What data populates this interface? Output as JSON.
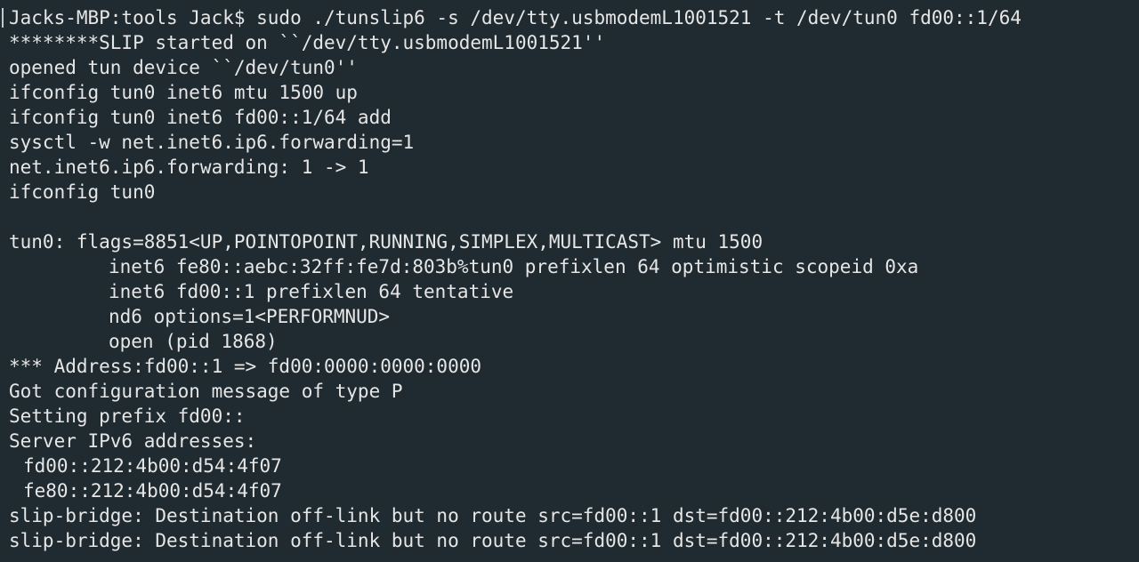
{
  "terminal": {
    "lines": [
      "Jacks-MBP:tools Jack$ sudo ./tunslip6 -s /dev/tty.usbmodemL1001521 -t /dev/tun0 fd00::1/64",
      "********SLIP started on ``/dev/tty.usbmodemL1001521''",
      "opened tun device ``/dev/tun0''",
      "ifconfig tun0 inet6 mtu 1500 up",
      "ifconfig tun0 inet6 fd00::1/64 add",
      "sysctl -w net.inet6.ip6.forwarding=1",
      "net.inet6.ip6.forwarding: 1 -> 1",
      "ifconfig tun0",
      "",
      "tun0: flags=8851<UP,POINTOPOINT,RUNNING,SIMPLEX,MULTICAST> mtu 1500",
      "inet6 fe80::aebc:32ff:fe7d:803b%tun0 prefixlen 64 optimistic scopeid 0xa",
      "inet6 fd00::1 prefixlen 64 tentative",
      "nd6 options=1<PERFORMNUD>",
      "open (pid 1868)",
      "*** Address:fd00::1 => fd00:0000:0000:0000",
      "Got configuration message of type P",
      "Setting prefix fd00::",
      "Server IPv6 addresses:",
      "fd00::212:4b00:d54:4f07",
      "fe80::212:4b00:d54:4f07",
      "slip-bridge: Destination off-link but no route src=fd00::1 dst=fd00::212:4b00:d5e:d800",
      "slip-bridge: Destination off-link but no route src=fd00::1 dst=fd00::212:4b00:d5e:d800"
    ]
  },
  "colors": {
    "background": "#1f2b30",
    "foreground": "#e6e6e6"
  }
}
